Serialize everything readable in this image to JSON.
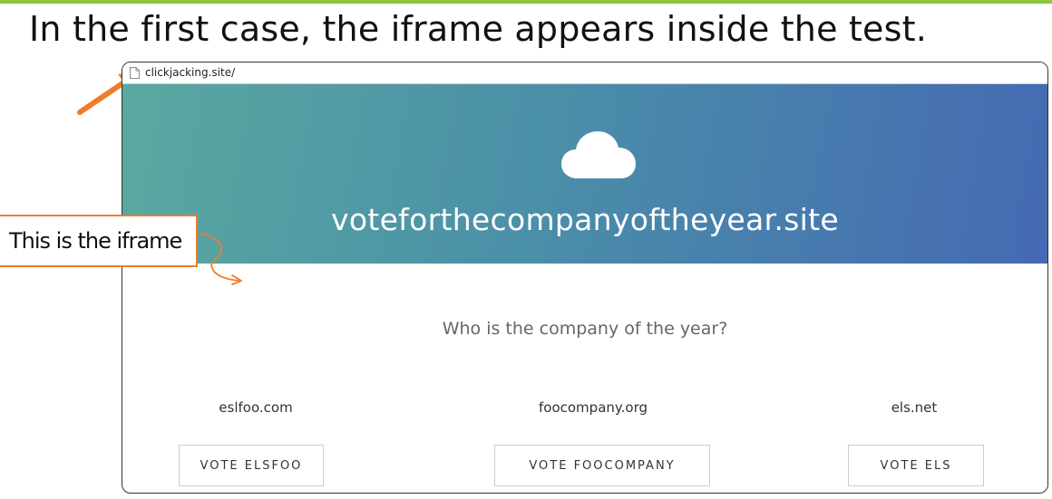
{
  "slide": {
    "title": "In the first case, the iframe appears inside the test.",
    "accent_color": "#8cc63f",
    "annotation_color": "#ee7d2b"
  },
  "browser": {
    "url": "clickjacking.site/",
    "page_icon": "document-icon"
  },
  "iframe_page": {
    "hero_icon": "cloud-icon",
    "site_name": "voteforthecompanyoftheyear.site",
    "question": "Who is the company of the year?",
    "candidates": [
      {
        "company": "eslfoo.com",
        "button_label": "VOTE ELSFOO"
      },
      {
        "company": "foocompany.org",
        "button_label": "VOTE FOOCOMPANY"
      },
      {
        "company": "els.net",
        "button_label": "VOTE ELS"
      }
    ]
  },
  "annotations": {
    "callout_text": "This is the iframe"
  }
}
